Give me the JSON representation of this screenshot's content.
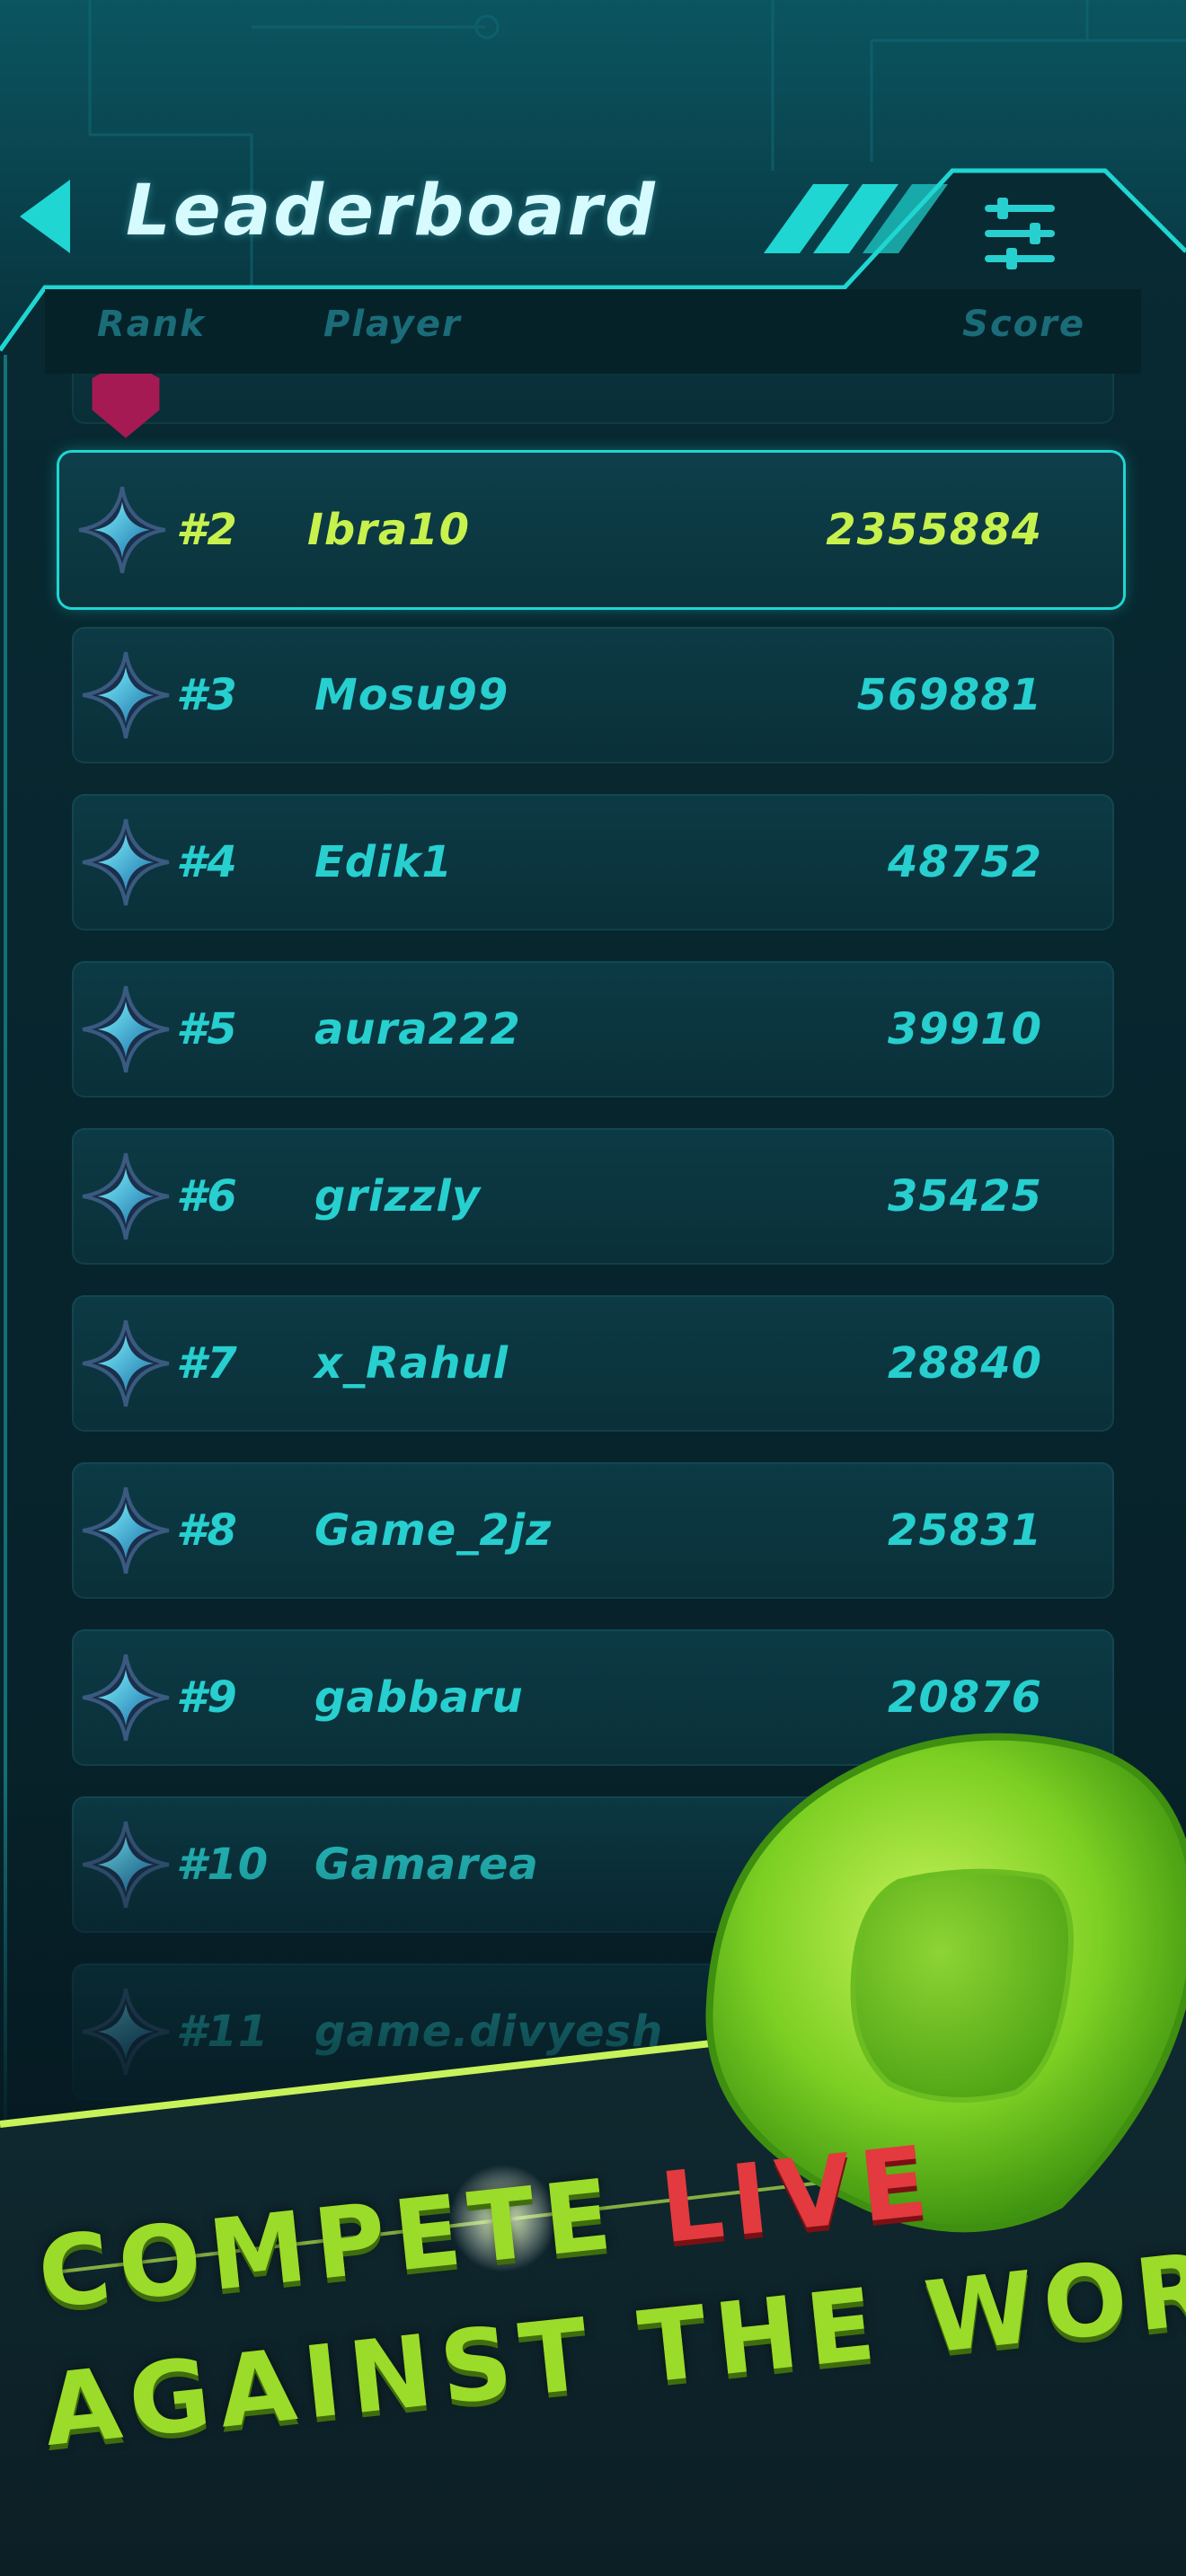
{
  "header": {
    "title": "Leaderboard",
    "back_icon": "back-arrow-icon",
    "filter_icon": "sliders-icon"
  },
  "columns": {
    "rank": "Rank",
    "player": "Player",
    "score": "Score"
  },
  "leaderboard": [
    {
      "rank": "#2",
      "player": "Ibra10",
      "score": "2355884",
      "highlighted": true
    },
    {
      "rank": "#3",
      "player": "Mosu99",
      "score": "569881"
    },
    {
      "rank": "#4",
      "player": "Edik1",
      "score": "48752"
    },
    {
      "rank": "#5",
      "player": "aura222",
      "score": "39910"
    },
    {
      "rank": "#6",
      "player": "grizzly",
      "score": "35425"
    },
    {
      "rank": "#7",
      "player": "x_Rahul",
      "score": "28840"
    },
    {
      "rank": "#8",
      "player": "Game_2jz",
      "score": "25831"
    },
    {
      "rank": "#9",
      "player": "gabbaru",
      "score": "20876"
    },
    {
      "rank": "#10",
      "player": "Gamarea",
      "score": ""
    },
    {
      "rank": "#11",
      "player": "game.divyesh",
      "score": ""
    }
  ],
  "promo": {
    "line1_part1": "COMPETE",
    "line1_part2": "LIVE",
    "line2": "AGAINST THE WORLD!"
  },
  "colors": {
    "accent": "#27cfcf",
    "highlight": "#c7f14d",
    "promo_green": "#9bdb2a",
    "promo_red": "#e23a3e",
    "background": "#061a22"
  }
}
